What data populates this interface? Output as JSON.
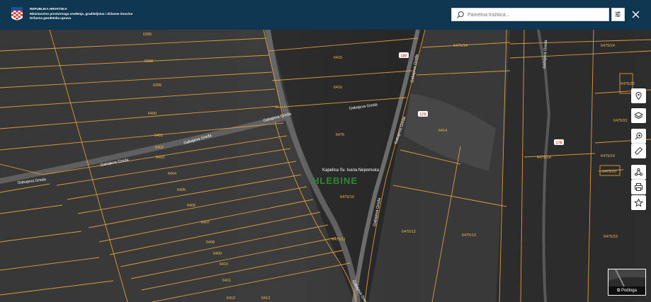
{
  "header": {
    "ministry_line1": "REPUBLIKA HRVATSKA",
    "ministry_line2": "Ministarstvo prostornoga uređenja, graditeljstva i državne imovine",
    "ministry_line3": "Državna geodetska uprava",
    "crest_icon": "croatian-coat-of-arms-icon"
  },
  "search": {
    "placeholder": "Pametna tražilica..."
  },
  "icons": {
    "search": "search-icon",
    "filter": "filter-icon",
    "close": "close-icon"
  },
  "tools": [
    {
      "name": "location-tool",
      "icon": "map-pin-icon"
    },
    {
      "name": "layers-tool",
      "icon": "layers-icon"
    },
    {
      "name": "zoom-tool",
      "icon": "zoom-in-icon"
    },
    {
      "name": "measure-tool",
      "icon": "ruler-icon"
    },
    {
      "name": "share-tool",
      "icon": "share-icon"
    },
    {
      "name": "print-tool",
      "icon": "print-icon"
    },
    {
      "name": "favourite-tool",
      "icon": "star-icon"
    }
  ],
  "basemap": {
    "label": "Podloga"
  },
  "map": {
    "streets": [
      {
        "name": "Gabajeva Greda"
      },
      {
        "name": "Gabajeva Greda"
      },
      {
        "name": "Gabajeva Greda"
      },
      {
        "name": "Gabajeva Greda"
      },
      {
        "name": "Gabajeva Greda"
      },
      {
        "name": "Gabajeva Greda"
      },
      {
        "name": "Gabajeva Greda"
      },
      {
        "name": "Gabajeva Greda"
      },
      {
        "name": "Gabajeva Greda"
      },
      {
        "name": "Gabajeva Greda"
      }
    ],
    "place_label": "HLEBINE",
    "chapel_label": "Kapelica Sv. Ivana Nepomuka",
    "house_numbers": [
      "180",
      "179",
      "178"
    ],
    "parcels": [
      "6396",
      "6398",
      "6399",
      "6400",
      "6401",
      "6402",
      "6403",
      "6404",
      "6405",
      "6406",
      "6407",
      "6408",
      "6409",
      "6410",
      "6411",
      "6412",
      "6413",
      "6414",
      "6415",
      "6416",
      "6476",
      "6475/10",
      "6475/11",
      "6475/12",
      "6475/13",
      "6475/14",
      "6475/18",
      "6475/19",
      "6475/20",
      "6475/21",
      "6475/22",
      "6475/23",
      "6475/24",
      "6475/25",
      "6475/27",
      "6475/29",
      "6475/30"
    ]
  },
  "colors": {
    "header_bg": "#0e3651",
    "parcel_line": "#e6a23c",
    "parcel_text": "#f2b84b",
    "place_label": "#2f8a2f",
    "house_number": "#d24a2b"
  }
}
